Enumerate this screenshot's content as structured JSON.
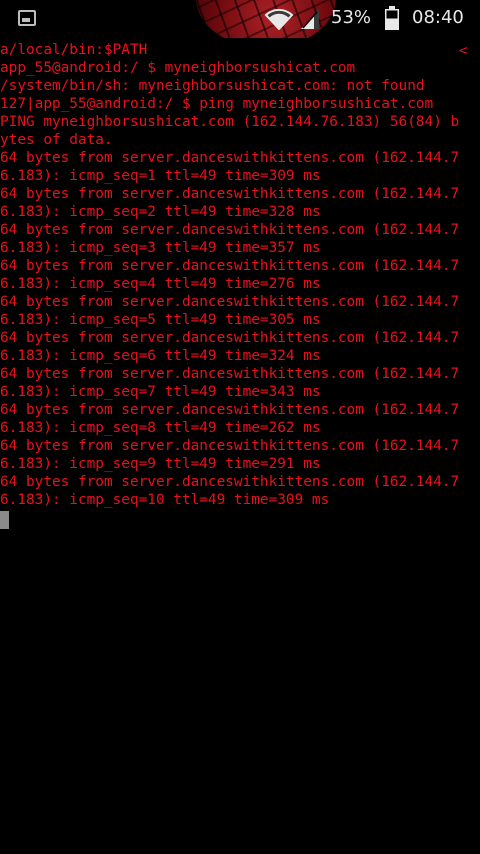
{
  "status_bar": {
    "battery_percent": "53%",
    "time": "08:40",
    "icons": [
      "notification-icon",
      "wifi-icon",
      "signal-icon",
      "battery-icon"
    ]
  },
  "terminal": {
    "text_color": "#e8111a",
    "scroll_indicator": "<",
    "lines": [
      "a/local/bin:$PATH",
      "app_55@android:/ $ myneighborsushicat.com",
      "/system/bin/sh: myneighborsushicat.com: not found",
      "127|app_55@android:/ $ ping myneighborsushicat.com",
      "PING myneighborsushicat.com (162.144.76.183) 56(84) b",
      "ytes of data.",
      "64 bytes from server.danceswithkittens.com (162.144.7",
      "6.183): icmp_seq=1 ttl=49 time=309 ms",
      "64 bytes from server.danceswithkittens.com (162.144.7",
      "6.183): icmp_seq=2 ttl=49 time=328 ms",
      "64 bytes from server.danceswithkittens.com (162.144.7",
      "6.183): icmp_seq=3 ttl=49 time=357 ms",
      "64 bytes from server.danceswithkittens.com (162.144.7",
      "6.183): icmp_seq=4 ttl=49 time=276 ms",
      "64 bytes from server.danceswithkittens.com (162.144.7",
      "6.183): icmp_seq=5 ttl=49 time=305 ms",
      "64 bytes from server.danceswithkittens.com (162.144.7",
      "6.183): icmp_seq=6 ttl=49 time=324 ms",
      "64 bytes from server.danceswithkittens.com (162.144.7",
      "6.183): icmp_seq=7 ttl=49 time=343 ms",
      "64 bytes from server.danceswithkittens.com (162.144.7",
      "6.183): icmp_seq=8 ttl=49 time=262 ms",
      "64 bytes from server.danceswithkittens.com (162.144.7",
      "6.183): icmp_seq=9 ttl=49 time=291 ms",
      "64 bytes from server.danceswithkittens.com (162.144.7",
      "6.183): icmp_seq=10 ttl=49 time=309 ms"
    ]
  }
}
